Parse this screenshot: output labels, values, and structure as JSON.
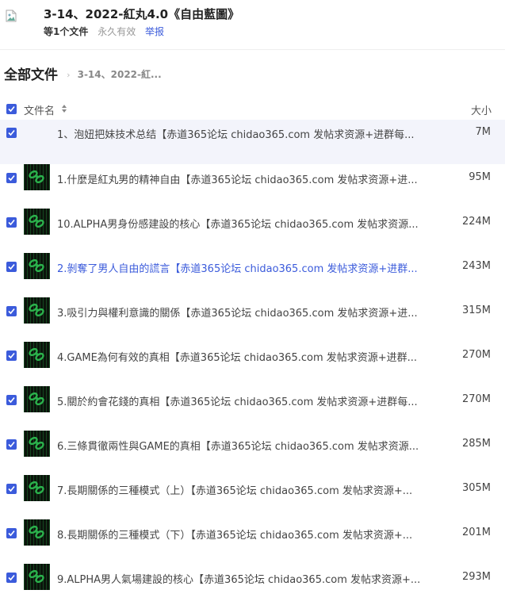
{
  "header": {
    "title": "3-14、2022-紅丸4.0《自由藍圖》",
    "file_count": "等1个文件",
    "validity": "永久有效",
    "report": "举报"
  },
  "breadcrumb": {
    "all_files": "全部文件",
    "current": "3-14、2022-紅..."
  },
  "list": {
    "col_name": "文件名",
    "col_size": "大小"
  },
  "colors": {
    "accent": "#3b5bdb",
    "row_highlight": "#f3f4fb",
    "thumb_green": "#2bb24c"
  },
  "files": [
    {
      "name": "1、泡妞把妹技术总结【赤道365论坛 chidao365.com 发帖求资源+进群每...",
      "size": "7M"
    },
    {
      "name": "1.什麼是紅丸男的精神自由【赤道365论坛 chidao365.com 发帖求资源+进...",
      "size": "95M"
    },
    {
      "name": "10.ALPHA男身份感建設的核心【赤道365论坛 chidao365.com 发帖求资源...",
      "size": "224M"
    },
    {
      "name": "2.剝奪了男人自由的謊言【赤道365论坛 chidao365.com 发帖求资源+进群...",
      "size": "243M"
    },
    {
      "name": "3.吸引力與權利意識的關係【赤道365论坛 chidao365.com 发帖求资源+进...",
      "size": "315M"
    },
    {
      "name": "4.GAME為何有效的真相【赤道365论坛 chidao365.com 发帖求资源+进群...",
      "size": "270M"
    },
    {
      "name": "5.關於約會花錢的真相【赤道365论坛 chidao365.com 发帖求资源+进群每...",
      "size": "270M"
    },
    {
      "name": "6.三條貫徹兩性與GAME的真相【赤道365论坛 chidao365.com 发帖求资源...",
      "size": "285M"
    },
    {
      "name": "7.長期關係的三種模式（上）【赤道365论坛 chidao365.com 发帖求资源+...",
      "size": "305M"
    },
    {
      "name": "8.長期關係的三種模式（下）【赤道365论坛 chidao365.com 发帖求资源+...",
      "size": "201M"
    },
    {
      "name": "9.ALPHA男人氣場建設的核心【赤道365论坛 chidao365.com 发帖求资源+...",
      "size": "293M"
    }
  ]
}
